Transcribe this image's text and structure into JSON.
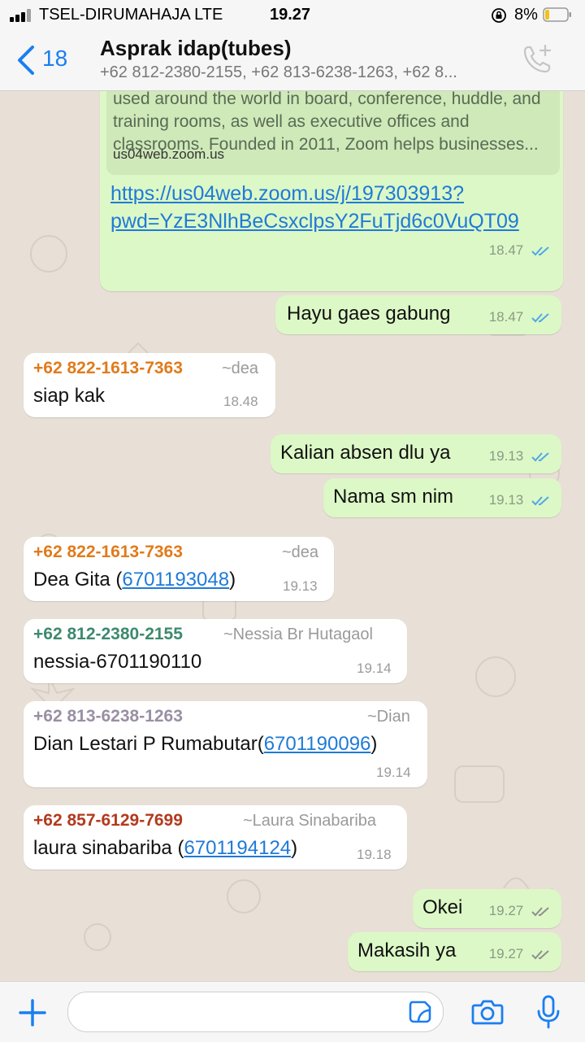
{
  "status": {
    "carrier": "TSEL-DIRUMAHAJA  LTE",
    "time": "19.27",
    "battery": "8%"
  },
  "header": {
    "back_count": "18",
    "title": "Asprak idap(tubes)",
    "members": "+62 812-2380-2155, +62 813-6238-1263, +62 8..."
  },
  "colors": {
    "accent": "#1a7ef2",
    "outgoing_bubble": "#dcf8c6",
    "incoming_bubble": "#ffffff",
    "read_ticks": "#4fa8e8",
    "delivered_ticks": "#8e8e8e"
  },
  "messages": [
    {
      "preview_desc": "the original software-based conference room solution used around the world in board, conference, huddle, and training rooms, as well as executive offices and classrooms. Founded in 2011, Zoom helps businesses...",
      "preview_domain": "us04web.zoom.us",
      "link_line1": "https://us04web.zoom.us/j/197303913?",
      "link_line2": "pwd=YzE3NlhBeCsxclpsY2FuTjd6c0VuQT09",
      "time": "18.47"
    },
    {
      "text": "Hayu gaes gabung",
      "time": "18.47"
    },
    {
      "sender": "+62 822-1613-7363",
      "alias": "~dea",
      "text": "siap kak",
      "time": "18.48"
    },
    {
      "text": "Kalian absen dlu ya",
      "time": "19.13"
    },
    {
      "text": "Nama sm nim",
      "time": "19.13"
    },
    {
      "sender": "+62 822-1613-7363",
      "alias": "~dea",
      "text_before": "Dea Gita (",
      "link": "6701193048",
      "text_after": ")",
      "time": "19.13"
    },
    {
      "sender": "+62 812-2380-2155",
      "alias": "~Nessia Br Hutagaol",
      "text": "nessia-6701190110",
      "time": "19.14"
    },
    {
      "sender": "+62 813-6238-1263",
      "alias": "~Dian",
      "text_before": "Dian Lestari P Rumabutar(",
      "link": "6701190096",
      "text_after": ")",
      "time": "19.14"
    },
    {
      "sender": "+62 857-6129-7699",
      "alias": "~Laura Sinabariba",
      "text_before": "laura sinabariba (",
      "link": "6701194124",
      "text_after": ")",
      "time": "19.18"
    },
    {
      "text": "Okei",
      "time": "19.27"
    },
    {
      "text": "Makasih ya",
      "time": "19.27"
    }
  ],
  "sender_colors": [
    "#e07b1c",
    "#e07b1c",
    "#3d8a6e",
    "#9a8fa3",
    "#b23a1e"
  ],
  "icons": {
    "back": "chevron-left-icon",
    "call": "add-call-icon",
    "plus": "plus-icon",
    "sticker": "sticker-icon",
    "camera": "camera-icon",
    "mic": "microphone-icon"
  }
}
